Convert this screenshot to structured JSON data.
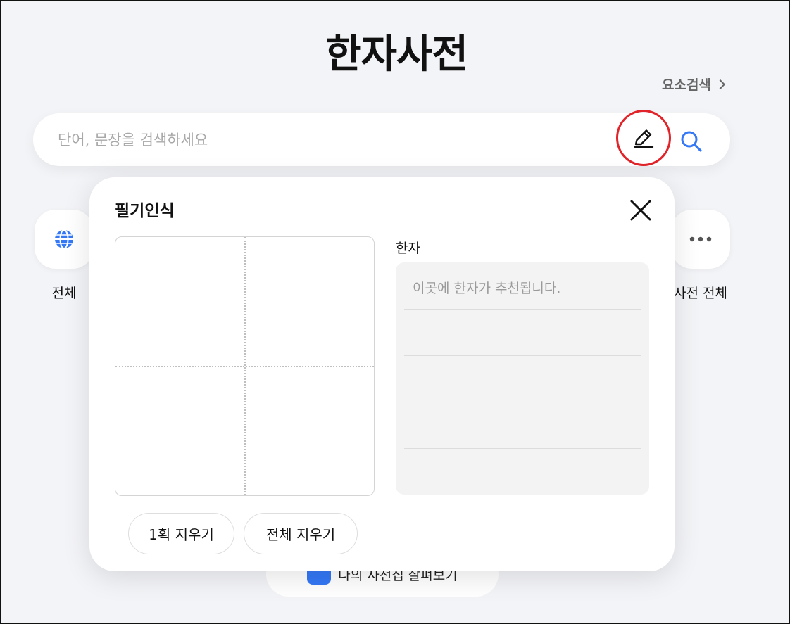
{
  "header": {
    "title": "한자사전",
    "element_search_label": "요소검색"
  },
  "search": {
    "placeholder": "단어, 문장을 검색하세요",
    "value": ""
  },
  "categories": [
    {
      "label": "전체",
      "icon": "globe-icon"
    },
    {
      "label": "사전 전체",
      "icon": "more-dots-icon"
    }
  ],
  "bottom_pill": {
    "label": "나의 사전집 살펴보기"
  },
  "handwriting_panel": {
    "title": "필기인식",
    "hanja_label": "한자",
    "hanja_placeholder": "이곳에 한자가 추천됩니다.",
    "erase_one_label": "1획 지우기",
    "erase_all_label": "전체 지우기"
  },
  "colors": {
    "accent_blue": "#3478f6",
    "highlight_red": "#e0242a",
    "background": "#f3f4f7"
  }
}
